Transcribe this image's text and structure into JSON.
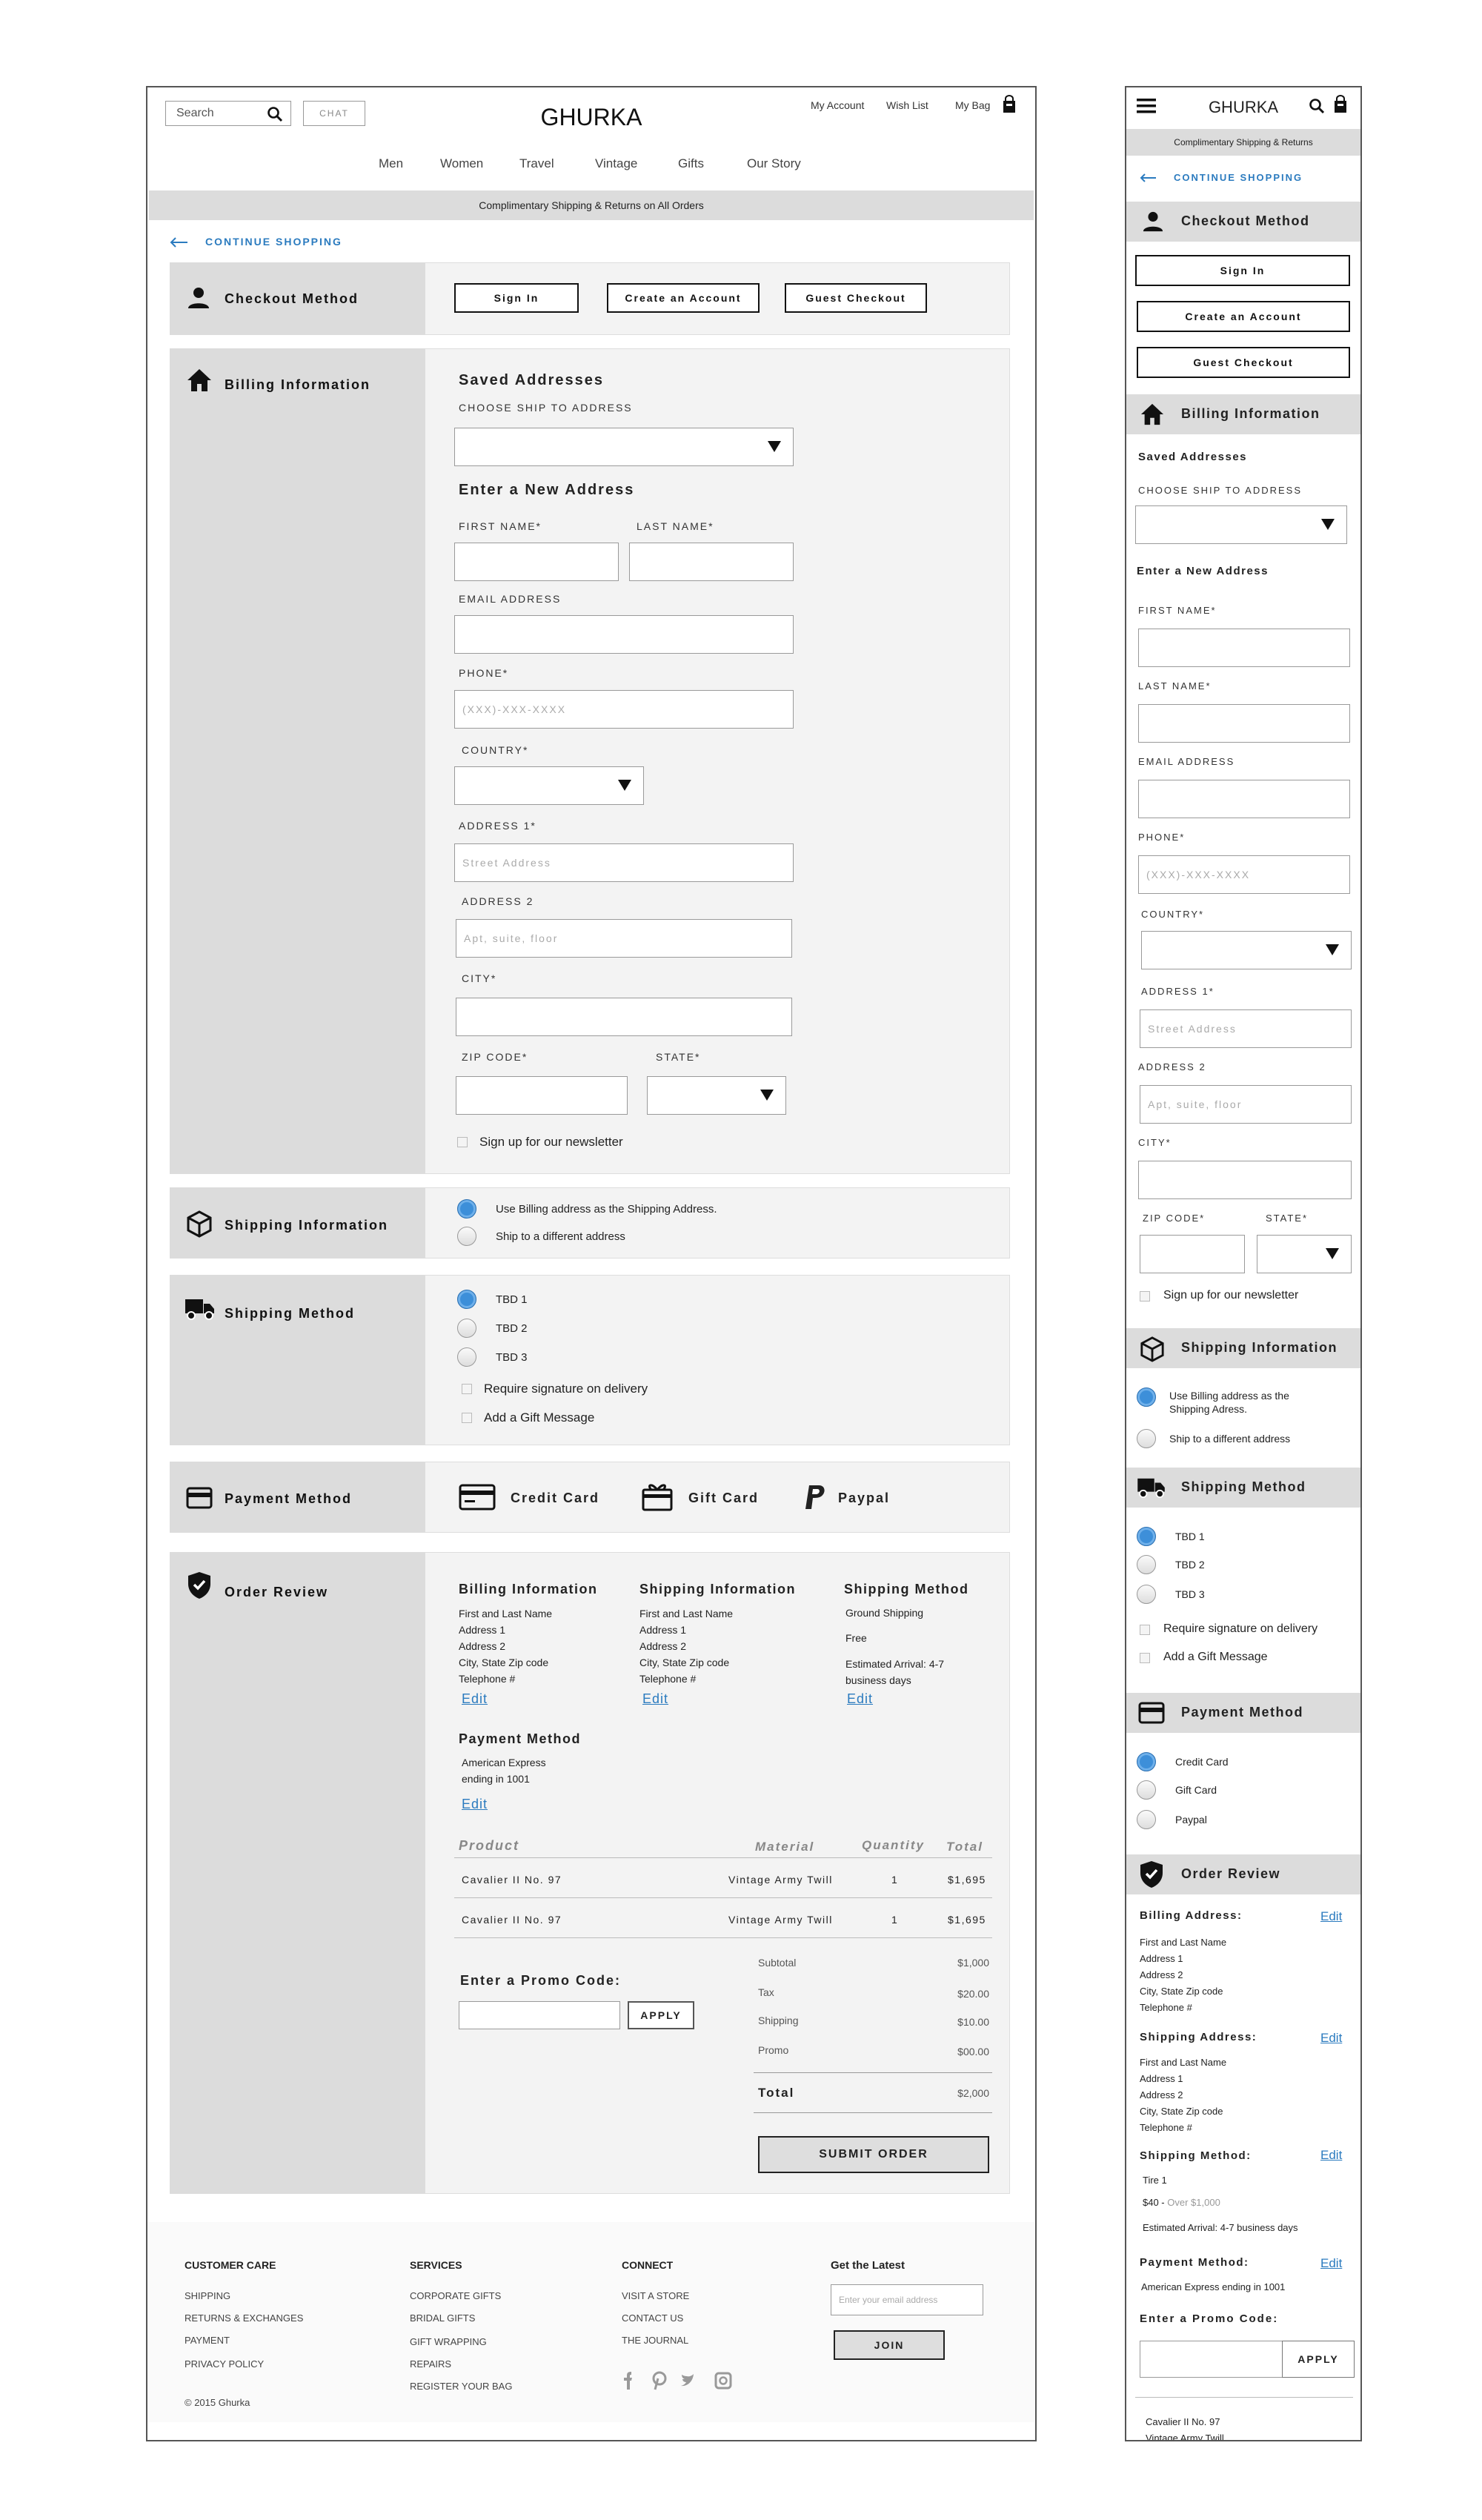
{
  "brand": "GHURKA",
  "header": {
    "search_placeholder": "Search",
    "chat": "CHAT",
    "my_account": "My Account",
    "wish_list": "Wish List",
    "my_bag": "My Bag"
  },
  "nav": [
    "Men",
    "Women",
    "Travel",
    "Vintage",
    "Gifts",
    "Our Story"
  ],
  "promo_banner": "Complimentary Shipping & Returns on All Orders",
  "mobile_promo_banner": "Complimentary Shipping & Returns",
  "continue_shopping": "CONTINUE SHOPPING",
  "checkout_method": {
    "title": "Checkout Method",
    "sign_in": "Sign In",
    "create_account": "Create an Account",
    "guest": "Guest Checkout"
  },
  "billing": {
    "title": "Billing Information",
    "saved_addresses": "Saved Addresses",
    "choose_ship": "CHOOSE SHIP TO ADDRESS",
    "new_address": "Enter a New Address",
    "first_name": "FIRST NAME*",
    "last_name": "LAST NAME*",
    "email": "EMAIL ADDRESS",
    "phone": "PHONE*",
    "phone_placeholder": "(XXX)-XXX-XXXX",
    "country": "COUNTRY*",
    "address1": "ADDRESS 1*",
    "address1_placeholder": "Street Address",
    "address2": "ADDRESS 2",
    "address2_placeholder": "Apt, suite, floor",
    "city": "CITY*",
    "zip": "ZIP CODE*",
    "state": "STATE*",
    "newsletter": "Sign up for our newsletter"
  },
  "shipping_info": {
    "title": "Shipping Information",
    "opt1": "Use Billing address as the Shipping Address.",
    "opt1_mobile": "Use Billing address as the Shipping Adress.",
    "opt2": "Ship to a different address"
  },
  "shipping_method": {
    "title": "Shipping Method",
    "options": [
      "TBD 1",
      "TBD 2",
      "TBD 3"
    ],
    "signature": "Require signature on delivery",
    "gift_message": "Add a Gift Message"
  },
  "payment": {
    "title": "Payment Method",
    "credit": "Credit Card",
    "gift": "Gift Card",
    "paypal": "Paypal"
  },
  "order_review": {
    "title": "Order Review",
    "billing_title": "Billing Information",
    "shipping_title": "Shipping Information",
    "method_title": "Shipping Method",
    "payment_title": "Payment Method",
    "address_lines": [
      "First and Last Name",
      "Address 1",
      "Address 2",
      "City, State Zip code",
      "Telephone #"
    ],
    "method_lines": [
      "Ground Shipping",
      "Free",
      "Estimated Arrival: 4-7 business days"
    ],
    "payment_lines": [
      "American Express",
      "ending in 1001"
    ],
    "edit": "Edit",
    "columns": {
      "product": "Product",
      "material": "Material",
      "quantity": "Quantity",
      "total": "Total"
    },
    "items": [
      {
        "product": "Cavalier II No. 97",
        "material": "Vintage Army Twill",
        "qty": "1",
        "total": "$1,695"
      },
      {
        "product": "Cavalier II No. 97",
        "material": "Vintage Army Twill",
        "qty": "1",
        "total": "$1,695"
      }
    ],
    "promo_label": "Enter a Promo Code:",
    "apply": "APPLY",
    "summary": [
      {
        "label": "Subtotal",
        "value": "$1,000"
      },
      {
        "label": "Tax",
        "value": "$20.00"
      },
      {
        "label": "Shipping",
        "value": "$10.00"
      },
      {
        "label": "Promo",
        "value": "$00.00"
      }
    ],
    "total_label": "Total",
    "total_value": "$2,000",
    "submit": "SUBMIT ORDER"
  },
  "footer": {
    "care_title": "CUSTOMER CARE",
    "care": [
      "SHIPPING",
      "RETURNS & EXCHANGES",
      "PAYMENT",
      "PRIVACY POLICY"
    ],
    "services_title": "SERVICES",
    "services": [
      "CORPORATE GIFTS",
      "BRIDAL GIFTS",
      "GIFT WRAPPING",
      "REPAIRS",
      "REGISTER YOUR BAG"
    ],
    "connect_title": "CONNECT",
    "connect": [
      "VISIT A STORE",
      "CONTACT US",
      "THE JOURNAL"
    ],
    "latest_title": "Get the Latest",
    "email_placeholder": "Enter your email address",
    "join": "JOIN",
    "copyright": "© 2015 Ghurka"
  },
  "mobile": {
    "billing_address": "Billing Address:",
    "shipping_address": "Shipping Address:",
    "shipping_method": "Shipping Method:",
    "payment_method": "Payment Method:",
    "method_lines": [
      "Tire 1",
      "$40 - ",
      "Over $1,000",
      "Estimated Arrival: 4-7 business days"
    ],
    "payment_line": "American Express ending in 1001",
    "item_name": "Cavalier II No. 97",
    "item_material": "Vintage Army Twill"
  }
}
